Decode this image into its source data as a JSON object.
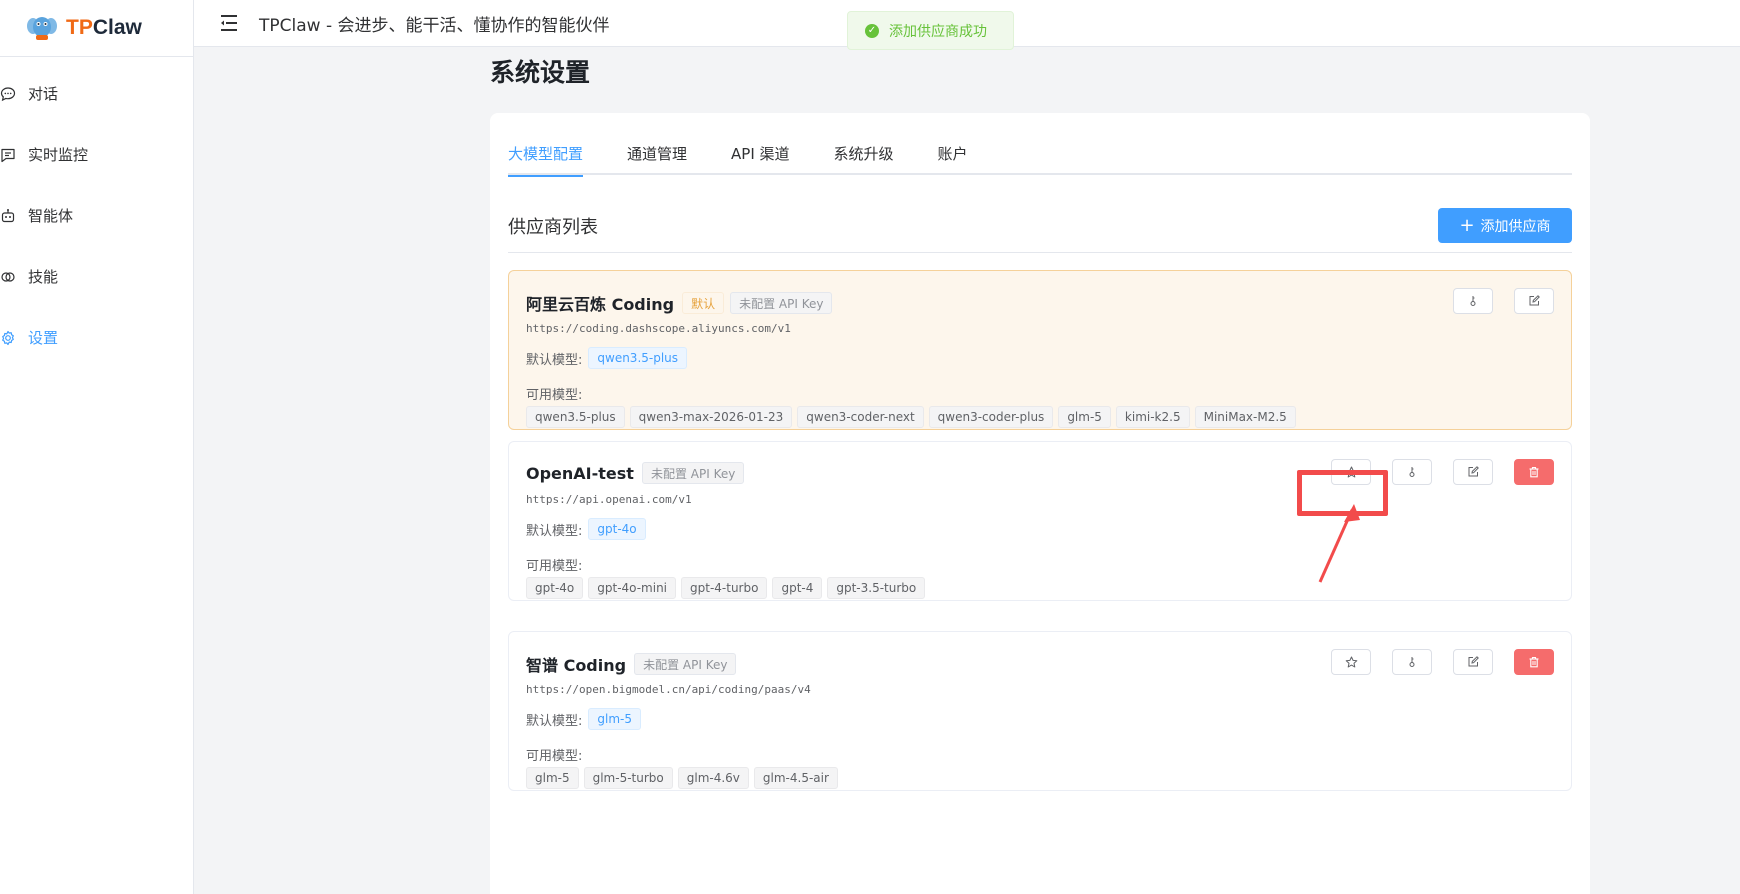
{
  "app": {
    "logo_tp": "TP",
    "logo_claw": "Claw",
    "header_title": "TPClaw - 会进步、能干活、懂协作的智能伙伴"
  },
  "sidebar": {
    "items": [
      {
        "label": "对话",
        "icon": "chat-icon"
      },
      {
        "label": "实时监控",
        "icon": "monitor-icon"
      },
      {
        "label": "智能体",
        "icon": "robot-icon"
      },
      {
        "label": "技能",
        "icon": "link-icon"
      },
      {
        "label": "设置",
        "icon": "gear-icon",
        "active": true
      }
    ]
  },
  "toast": {
    "text": "添加供应商成功"
  },
  "page": {
    "title": "系统设置",
    "tabs": [
      "大模型配置",
      "通道管理",
      "API 渠道",
      "系统升级",
      "账户"
    ],
    "section_title": "供应商列表",
    "add_button": "添加供应商",
    "default_model_label": "默认模型:",
    "available_models_label": "可用模型:"
  },
  "providers": [
    {
      "name": "阿里云百炼 Coding",
      "default_tag": "默认",
      "api_key_tag": "未配置 API Key",
      "url": "https://coding.dashscope.aliyuncs.com/v1",
      "default_model": "qwen3.5-plus",
      "models": [
        "qwen3.5-plus",
        "qwen3-max-2026-01-23",
        "qwen3-coder-next",
        "qwen3-coder-plus",
        "glm-5",
        "kimi-k2.5",
        "MiniMax-M2.5"
      ]
    },
    {
      "name": "OpenAI-test",
      "api_key_tag": "未配置 API Key",
      "url": "https://api.openai.com/v1",
      "default_model": "gpt-4o",
      "models": [
        "gpt-4o",
        "gpt-4o-mini",
        "gpt-4-turbo",
        "gpt-4",
        "gpt-3.5-turbo"
      ]
    },
    {
      "name": "智谱 Coding",
      "api_key_tag": "未配置 API Key",
      "url": "https://open.bigmodel.cn/api/coding/paas/v4",
      "default_model": "glm-5",
      "models": [
        "glm-5",
        "glm-5-turbo",
        "glm-4.6v",
        "glm-4.5-air"
      ]
    }
  ],
  "colors": {
    "primary": "#409eff",
    "danger": "#f56c6c",
    "success": "#67c23a",
    "warning": "#e6a23c",
    "annotation": "#f24b4b",
    "logo_orange": "#f06a16"
  }
}
